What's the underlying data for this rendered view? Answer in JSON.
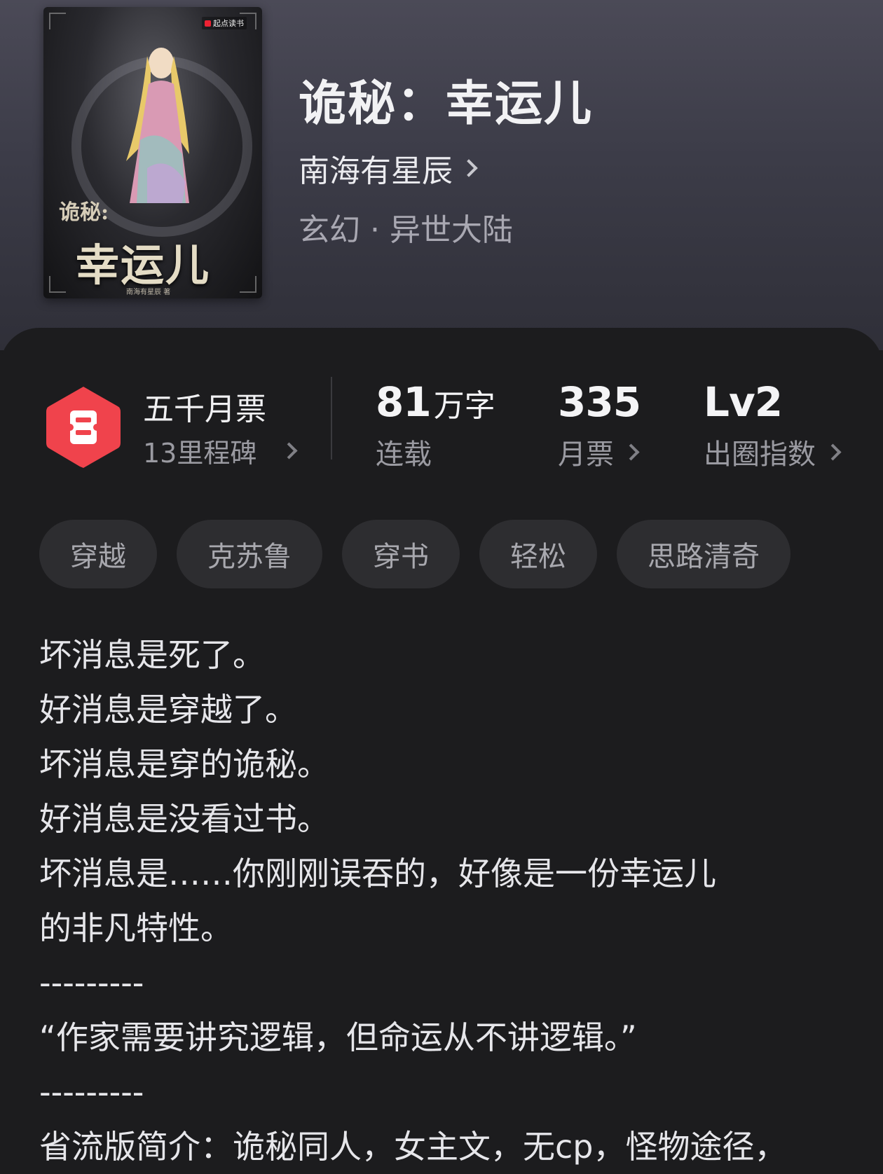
{
  "book": {
    "title": "诡秘：幸运儿",
    "author": "南海有星辰",
    "genre": "玄幻 · 异世大陆",
    "cover": {
      "publisher": "起点读书",
      "title_small": "诡秘:",
      "title_big": "幸运儿",
      "author": "南海有星辰 著"
    }
  },
  "badge": {
    "title": "五千月票",
    "subtitle": "13里程碑",
    "color": "#f0434c"
  },
  "stats": [
    {
      "value": "81",
      "unit": "万字",
      "label": "连载"
    },
    {
      "value": "335",
      "unit": "",
      "label": "月票"
    },
    {
      "value": "Lv2",
      "unit": "",
      "label": "出圈指数"
    }
  ],
  "tags": [
    "穿越",
    "克苏鲁",
    "穿书",
    "轻松",
    "思路清奇"
  ],
  "description": [
    "坏消息是死了。",
    "好消息是穿越了。",
    "坏消息是穿的诡秘。",
    "好消息是没看过书。",
    "坏消息是……你刚刚误吞的，好像是一份幸运儿",
    "的非凡特性。",
    "---------",
    "“作家需要讲究逻辑，但命运从不讲逻辑。”",
    "---------",
    "省流版简介：诡秘同人，女主文，无cp，怪物途径，"
  ]
}
